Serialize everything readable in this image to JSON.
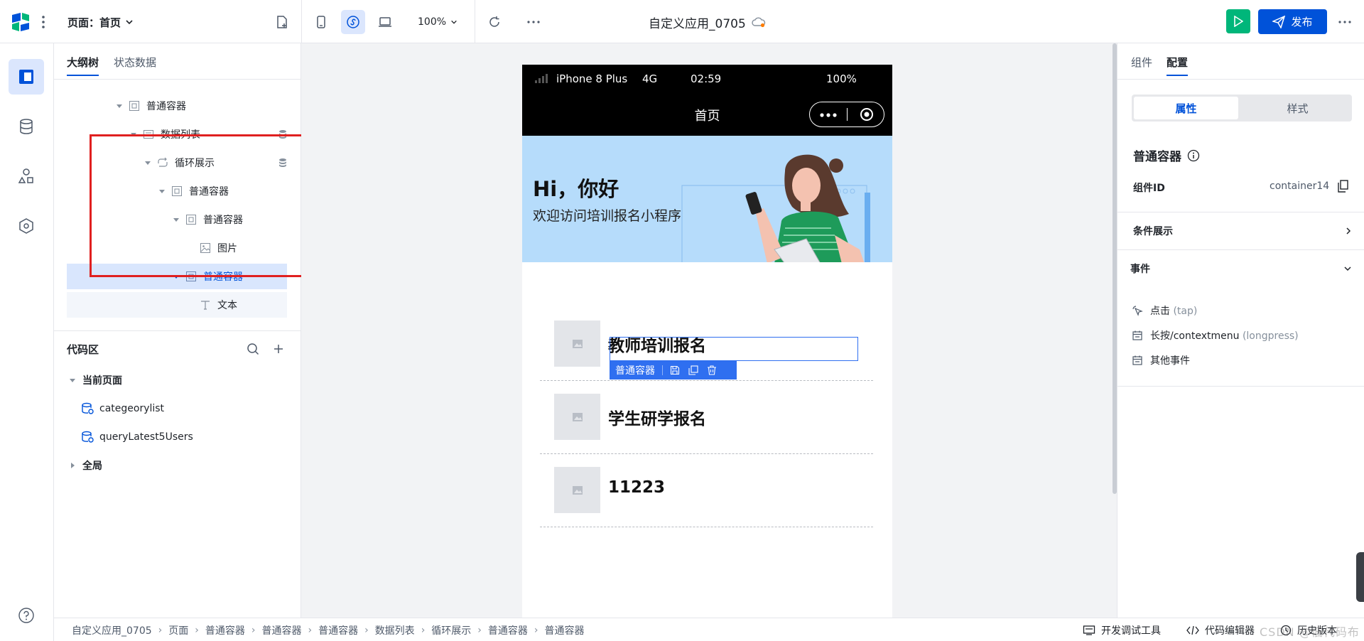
{
  "topbar": {
    "page_label": "页面：首页",
    "zoom": "100%",
    "app_title": "自定义应用_0705",
    "publish_label": "发布"
  },
  "left_panel": {
    "tabs": [
      "大纲树",
      "状态数据"
    ],
    "tree": [
      {
        "label": "普通容器"
      },
      {
        "label": "数据列表"
      },
      {
        "label": "循环展示"
      },
      {
        "label": "普通容器"
      },
      {
        "label": "普通容器"
      },
      {
        "label": "图片"
      },
      {
        "label": "普通容器"
      },
      {
        "label": "文本"
      }
    ],
    "code": {
      "title": "代码区",
      "current_page": "当前页面",
      "queries": [
        "categeorylist",
        "queryLatest5Users"
      ],
      "global": "全局"
    }
  },
  "phone": {
    "status": {
      "carrier": "iPhone 8 Plus",
      "network": "4G",
      "time": "02:59",
      "battery": "100%"
    },
    "nav_title": "首页",
    "banner": {
      "greeting": "Hi，你好",
      "subtitle": "欢迎访问培训报名小程序"
    },
    "items": [
      "教师培训报名",
      "学生研学报名",
      "11223"
    ],
    "selection_label": "普通容器"
  },
  "right_panel": {
    "tabs": [
      "组件",
      "配置"
    ],
    "segment": [
      "属性",
      "样式"
    ],
    "component_name": "普通容器",
    "component_id_label": "组件ID",
    "component_id": "container14",
    "conditional_label": "条件展示",
    "events_label": "事件",
    "events": [
      {
        "name": "点击",
        "hint": "(tap)"
      },
      {
        "name": "长按/contextmenu",
        "hint": "(longpress)"
      },
      {
        "name": "其他事件",
        "hint": ""
      }
    ]
  },
  "bottom": {
    "breadcrumbs": [
      "自定义应用_0705",
      "页面",
      "普通容器",
      "普通容器",
      "普通容器",
      "数据列表",
      "循环展示",
      "普通容器",
      "普通容器"
    ],
    "dev_tools": "开发调试工具",
    "code_editor": "代码编辑器",
    "history": "历史版本",
    "watermark": "CSDN @低代码布道师"
  },
  "colors": {
    "accent": "#0052d9",
    "run": "#00b67a",
    "highlight": "#e02020",
    "banner": "#b6dcfb"
  }
}
